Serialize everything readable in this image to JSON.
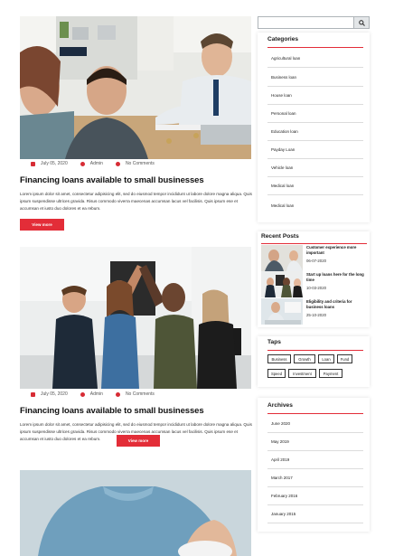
{
  "posts": [
    {
      "date": "July 05, 2020",
      "author": "Admin",
      "comments": "No Comments",
      "title": "Financing loans available to small businesses",
      "excerpt": "Lorem ipsum dolor sit amet, consectetur adipisicing elit, sed do eiusmod tempor incididunt ut labore dolore magna aliqua. Quis ipsum suspendisse ultrices gravida. Risus commodo viverra maecenas accumsan lacus vel facilisis. Quis ipsum ese et accumsan et iusto duo dolores et ea rebum.",
      "button": "View more"
    },
    {
      "date": "July 05, 2020",
      "author": "Admin",
      "comments": "No Comments",
      "title": "Financing loans available to small businesses",
      "excerpt": "Lorem ipsum dolor sit amet, consectetur adipisicing elit, sed do eiusmod tempor incididunt ut labore dolore magna aliqua. Quis ipsum suspendisse ultrices gravida. Risus commodo viverra maecenas accumsan lacus vel facilisis. Quis ipsum ese et accumsan et iusto duo dolores et ea rebum.",
      "button": "View more"
    }
  ],
  "search": {
    "placeholder": ""
  },
  "categories": {
    "title": "Categories",
    "items": [
      "Agricultural loan",
      "Business loan",
      "House loan",
      "Personal loan",
      "Education loan",
      "Payday Loan",
      "Vehicle loan",
      "Medical loan",
      "Medical loan"
    ]
  },
  "recent_posts": {
    "title": "Recent Posts",
    "items": [
      {
        "title": "Customer experience more important",
        "date": "06-07-2020"
      },
      {
        "title": "Start up loans here for the long time",
        "date": "10-03-2020"
      },
      {
        "title": "Eligibility and criteria for business loans",
        "date": "25-10-2020"
      }
    ]
  },
  "tags": {
    "title": "Taps",
    "items": [
      "Business",
      "Growth",
      "Loan",
      "Fund",
      "Speed",
      "Investment",
      "Payment"
    ]
  },
  "archives": {
    "title": "Archives",
    "items": [
      "June 2020",
      "May 2019",
      "April 2019",
      "March 2017",
      "February 2016",
      "January 2015"
    ]
  },
  "colors": {
    "accent": "#e32d38",
    "text": "#222222",
    "divider": "#dcdcdc"
  },
  "icons": {
    "date": "calendar-icon",
    "author": "user-icon",
    "comments": "comment-icon",
    "search": "search-icon"
  }
}
